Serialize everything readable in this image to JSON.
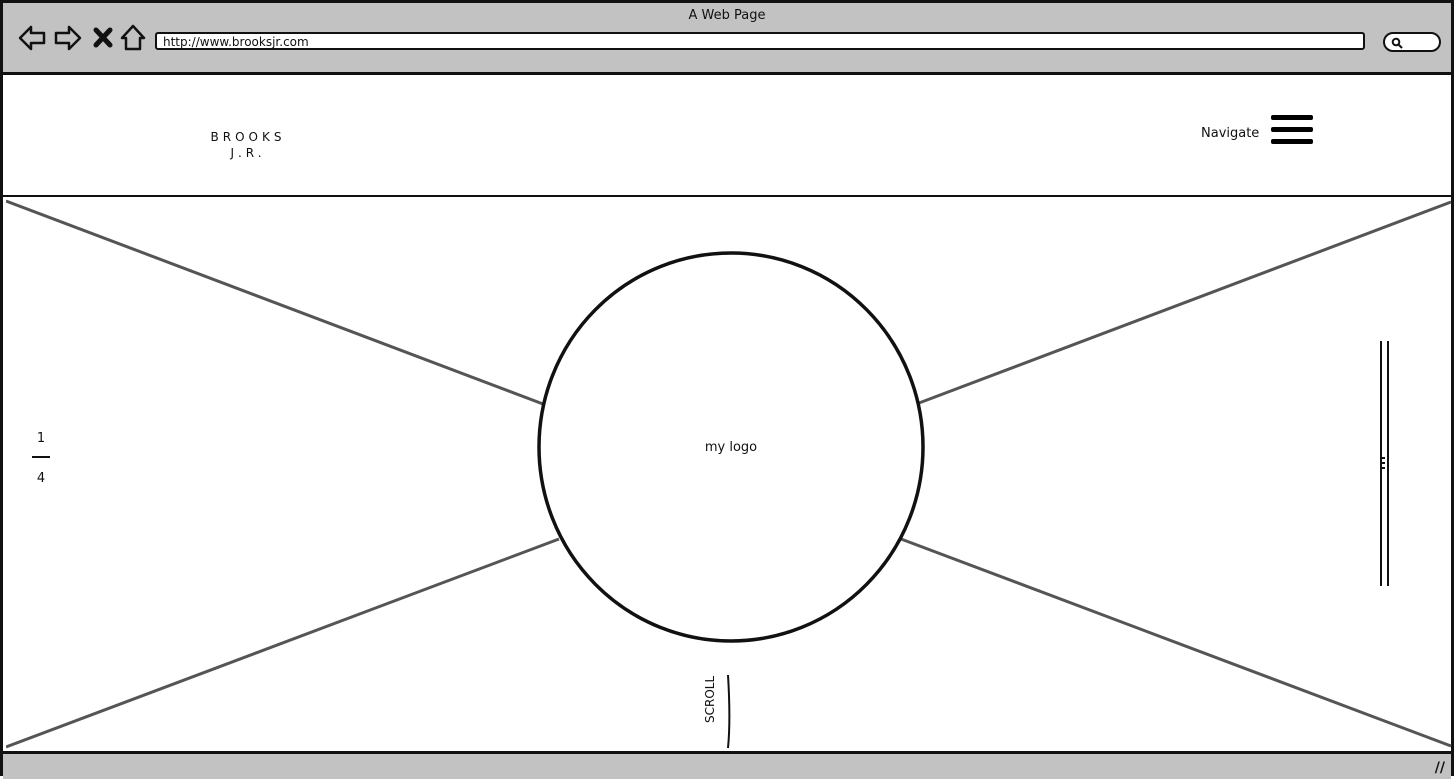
{
  "browser": {
    "window_title": "A Web Page",
    "url": "http://www.brooksjr.com",
    "search_placeholder": ""
  },
  "header": {
    "brand_line1": "BROOKS",
    "brand_line2": "J.R.",
    "nav_label": "Navigate",
    "menu_icon": "hamburger-menu-icon"
  },
  "hero": {
    "logo_text": "my logo",
    "slide_current": "1",
    "slide_total": "4",
    "scroll_label": "SCROLL"
  },
  "colors": {
    "chrome": "#c2c2c2",
    "outline": "#111111",
    "placeholder_lines": "#555555"
  }
}
